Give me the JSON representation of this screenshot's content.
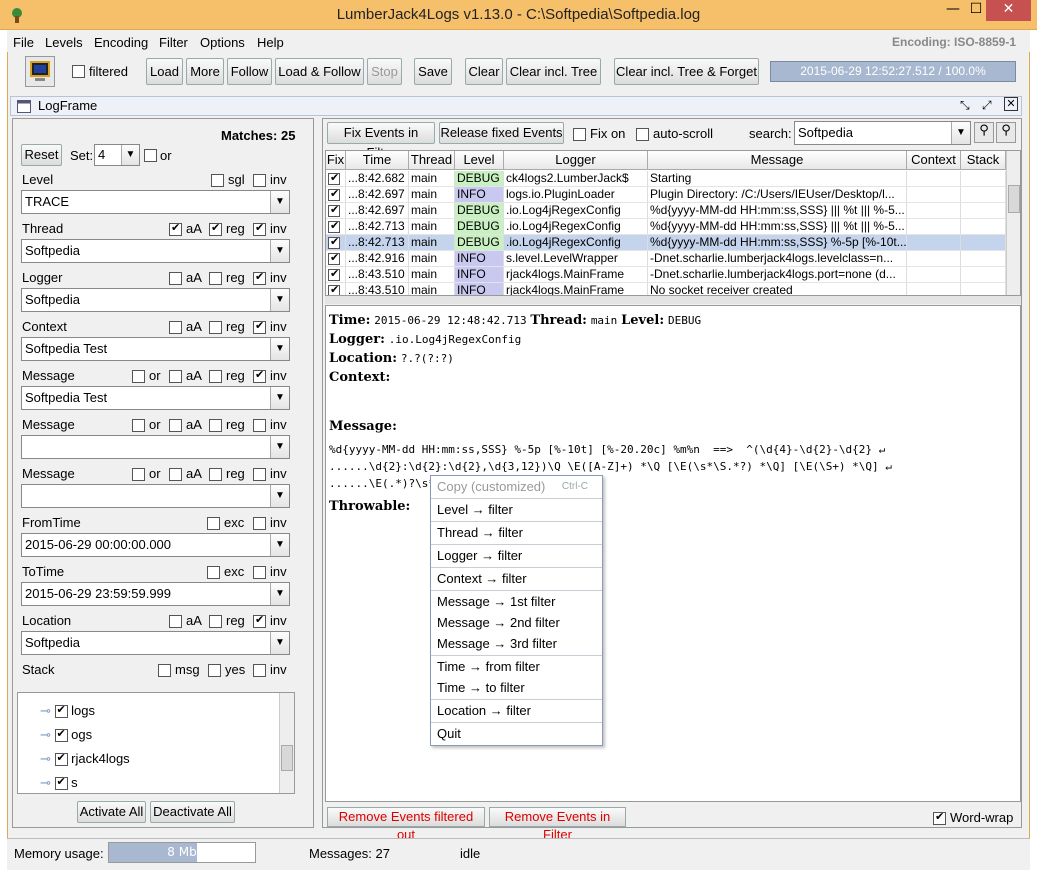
{
  "window": {
    "title": "LumberJack4Logs v1.13.0 - C:\\Softpedia\\Softpedia.log",
    "minimize": "—",
    "maximize": "☐",
    "close": "✕"
  },
  "menu": [
    "File",
    "Levels",
    "Encoding",
    "Filter",
    "Options",
    "Help"
  ],
  "encoding": "Encoding: ISO-8859-1",
  "toolbar": {
    "filtered": "filtered",
    "load": "Load",
    "more": "More",
    "follow": "Follow",
    "load_follow": "Load & Follow",
    "stop": "Stop",
    "save": "Save",
    "clear": "Clear",
    "clear_tree": "Clear incl. Tree",
    "clear_tree_forget": "Clear incl. Tree & Forget",
    "status": "2015-06-29 12:52:27.512 / 100.0%"
  },
  "logframe": {
    "title": "LogFrame"
  },
  "left": {
    "matches": "Matches: 25",
    "reset": "Reset",
    "set_label": "Set:",
    "set_value": "4",
    "or": "or",
    "level_label": "Level",
    "level_value": "TRACE",
    "sgl": "sgl",
    "inv": "inv",
    "thread_label": "Thread",
    "thread_value": "Softpedia",
    "aA": "aA",
    "reg": "reg",
    "logger_label": "Logger",
    "logger_value": "Softpedia",
    "context_label": "Context",
    "context_value": "Softpedia Test",
    "message_label": "Message",
    "message1_value": "Softpedia Test",
    "message2_value": "",
    "message3_value": "",
    "fromtime_label": "FromTime",
    "fromtime_value": "2015-06-29 00:00:00.000",
    "exc": "exc",
    "totime_label": "ToTime",
    "totime_value": "2015-06-29 23:59:59.999",
    "location_label": "Location",
    "location_value": "Softpedia",
    "stack_label": "Stack",
    "msg": "msg",
    "yes": "yes",
    "tree": [
      "logs",
      "ogs",
      "rjack4logs",
      "s"
    ],
    "activate_all": "Activate All",
    "deactivate_all": "Deactivate All"
  },
  "right": {
    "fix_events": "Fix Events in Filter",
    "release_fixed": "Release fixed Events",
    "fix_on": "Fix on",
    "auto_scroll": "auto-scroll",
    "search_label": "search:",
    "search_value": "Softpedia",
    "columns": [
      "Fix",
      "Time",
      "Thread",
      "Level",
      "Logger",
      "Message",
      "Context",
      "Stack"
    ],
    "rows": [
      {
        "time": "...8:42.682",
        "thread": "main",
        "level": "DEBUG",
        "logger": "ck4logs2.LumberJack$",
        "message": "Starting"
      },
      {
        "time": "...8:42.697",
        "thread": "main",
        "level": "INFO",
        "logger": "logs.io.PluginLoader",
        "message": "Plugin Directory: /C:/Users/IEUser/Desktop/l..."
      },
      {
        "time": "...8:42.697",
        "thread": "main",
        "level": "DEBUG",
        "logger": ".io.Log4jRegexConfig",
        "message": "%d{yyyy-MM-dd HH:mm:ss,SSS} ||| %t ||| %-5..."
      },
      {
        "time": "...8:42.713",
        "thread": "main",
        "level": "DEBUG",
        "logger": ".io.Log4jRegexConfig",
        "message": "%d{yyyy-MM-dd HH:mm:ss,SSS} ||| %t ||| %-5..."
      },
      {
        "time": "...8:42.713",
        "thread": "main",
        "level": "DEBUG",
        "logger": ".io.Log4jRegexConfig",
        "message": "%d{yyyy-MM-dd HH:mm:ss,SSS} %-5p [%-10t..."
      },
      {
        "time": "...8:42.916",
        "thread": "main",
        "level": "INFO",
        "logger": "s.level.LevelWrapper",
        "message": "-Dnet.scharlie.lumberjack4logs.levelclass=n..."
      },
      {
        "time": "...8:43.510",
        "thread": "main",
        "level": "INFO",
        "logger": "rjack4logs.MainFrame",
        "message": "-Dnet.scharlie.lumberjack4logs.port=none (d..."
      },
      {
        "time": "...8:43.510",
        "thread": "main",
        "level": "INFO",
        "logger": "rjack4logs.MainFrame",
        "message": "No socket receiver created"
      }
    ],
    "detail": {
      "time_label": "Time:",
      "time": "2015-06-29 12:48:42.713",
      "thread_label": "Thread:",
      "thread": "main",
      "level_label": "Level:",
      "level": "DEBUG",
      "logger_label": "Logger:",
      "logger": ".io.Log4jRegexConfig",
      "location_label": "Location:",
      "location": "?.?(?:?)",
      "context_label": "Context:",
      "message_label": "Message:",
      "msg1": "%d{yyyy-MM-dd HH:mm:ss,SSS} %-5p [%-10t] [%-20.20c] %m%n  ==>  ^(\\d{4}-\\d{2}-\\d{2} ↵",
      "msg2": "......\\d{2}:\\d{2}:\\d{2},\\d{3,12})\\Q \\E([A-Z]+) *\\Q [\\E(\\s*\\S.*?) *\\Q] [\\E(\\S+) *\\Q] ↵",
      "msg3": "......\\E(.*)?\\s*$",
      "throwable_label": "Throwable:"
    },
    "context_menu": {
      "copy": "Copy (customized)",
      "copy_shortcut": "Ctrl-C",
      "level": "Level → filter",
      "thread": "Thread → filter",
      "logger": "Logger → filter",
      "context": "Context → filter",
      "msg1": "Message → 1st filter",
      "msg2": "Message → 2nd filter",
      "msg3": "Message → 3rd filter",
      "time_from": "Time → from filter",
      "time_to": "Time → to filter",
      "location": "Location → filter",
      "quit": "Quit"
    },
    "remove_filtered_out": "Remove Events filtered out",
    "remove_in_filter": "Remove Events in Filter",
    "word_wrap": "Word-wrap"
  },
  "status": {
    "memory_label": "Memory usage:",
    "memory_value": "8 Mb",
    "messages": "Messages: 27",
    "state": "idle"
  },
  "colors": {
    "debug": "#c8f0c0",
    "info": "#c8c8f0",
    "selected": "#c4d4ec",
    "title": "#f6c06a"
  }
}
